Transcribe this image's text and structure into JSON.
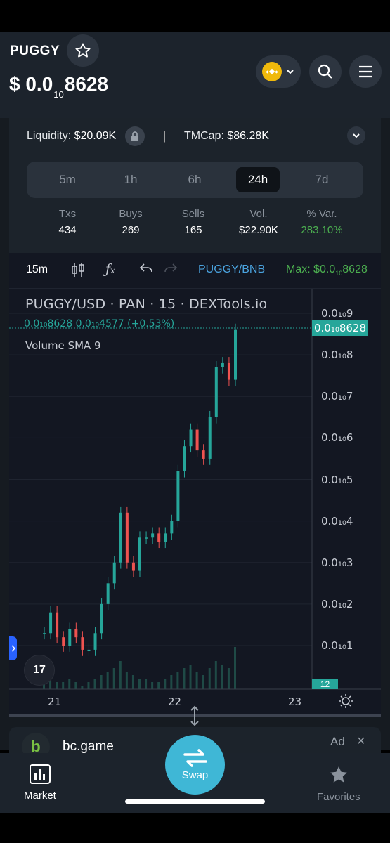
{
  "header": {
    "token": "PUGGY",
    "price_prefix": "$ 0.0",
    "price_sub": "10",
    "price_digits": "8628"
  },
  "stats": {
    "liquidity_label": "Liquidity:",
    "liquidity_value": "$20.09K",
    "separator": "|",
    "tmcap_label": "TMCap:",
    "tmcap_value": "$86.28K",
    "tabs": [
      "5m",
      "1h",
      "6h",
      "24h",
      "7d"
    ],
    "active_tab": "24h",
    "columns": [
      {
        "label": "Txs",
        "value": "434"
      },
      {
        "label": "Buys",
        "value": "269"
      },
      {
        "label": "Sells",
        "value": "165"
      },
      {
        "label": "Vol.",
        "value": "$22.90K"
      },
      {
        "label": "% Var.",
        "value": "283.10%"
      }
    ],
    "var_color": "#4caf50"
  },
  "toolbar": {
    "interval": "15m",
    "pair": "PUGGY/BNB",
    "max_prefix": "Max: $0.0",
    "max_sub": "10",
    "max_digits": "8628"
  },
  "chart": {
    "title": "PUGGY/USD · PAN · 15 · DEXTools.io",
    "ohlc": "0.0₁₀8628  0.0₁₀4577 (+0.53%)",
    "volume_label": "Volume SMA 9",
    "price_tag": "0.0₁₀8628",
    "volume_tag": "12",
    "y_labels": [
      "0.0₁₀9",
      "0.0₁₀8",
      "0.0₁₀7",
      "0.0₁₀6",
      "0.0₁₀5",
      "0.0₁₀4",
      "0.0₁₀3",
      "0.0₁₀2",
      "0.0₁₀1"
    ],
    "x_labels": [
      "21",
      "22",
      "23"
    ],
    "logo": "17"
  },
  "chart_data": {
    "type": "line",
    "title": "PUGGY/USD · PAN · 15 · DEXTools.io",
    "xlabel": "",
    "ylabel": "",
    "x_ticks": [
      "21",
      "22",
      "23"
    ],
    "ylim": [
      0,
      0.9
    ],
    "y_unit": "0.0₁₀ scale",
    "series": [
      {
        "name": "PUGGY/USD",
        "x": [
          0,
          1,
          2,
          3,
          4,
          5,
          6,
          7,
          8,
          9,
          10,
          11,
          12,
          13,
          14,
          15,
          16,
          17,
          18,
          19,
          20,
          21,
          22,
          23,
          24,
          25,
          26,
          27,
          28,
          29,
          30
        ],
        "values": [
          0.13,
          0.18,
          0.12,
          0.1,
          0.14,
          0.12,
          0.09,
          0.09,
          0.13,
          0.2,
          0.25,
          0.3,
          0.42,
          0.3,
          0.28,
          0.36,
          0.36,
          0.37,
          0.35,
          0.37,
          0.4,
          0.52,
          0.58,
          0.62,
          0.57,
          0.55,
          0.65,
          0.77,
          0.78,
          0.74,
          0.86
        ]
      }
    ],
    "volume": [
      3,
      5,
      2,
      2,
      3,
      2,
      1,
      2,
      3,
      4,
      5,
      6,
      8,
      5,
      4,
      3,
      3,
      2,
      2,
      3,
      4,
      5,
      6,
      7,
      5,
      4,
      6,
      8,
      7,
      6,
      12
    ]
  },
  "ad": {
    "logo": "b",
    "name": "bc.game",
    "label": "Ad",
    "close": "×"
  },
  "nav": {
    "market": "Market",
    "swap": "Swap",
    "favorites": "Favorites"
  }
}
